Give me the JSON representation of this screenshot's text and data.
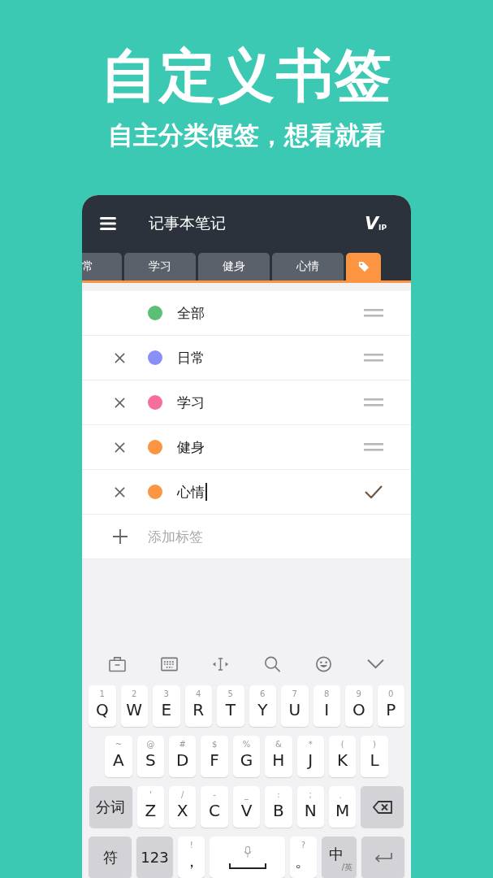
{
  "headline": "自定义书签",
  "subtitle": "自主分类便签，想看就看",
  "app": {
    "title": "记事本笔记",
    "vip_badge": {
      "main": "V",
      "sub": "IP"
    },
    "tabs": [
      {
        "kind": "text",
        "label": "常",
        "selected": false
      },
      {
        "kind": "text",
        "label": "学习",
        "selected": false
      },
      {
        "kind": "text",
        "label": "健身",
        "selected": false
      },
      {
        "kind": "text",
        "label": "心情",
        "selected": false
      },
      {
        "kind": "icon",
        "selected": true
      }
    ],
    "tags": [
      {
        "name": "全部",
        "color": "#5cbf78",
        "removable": false,
        "editing": false
      },
      {
        "name": "日常",
        "color": "#8a8ff5",
        "removable": true,
        "editing": false
      },
      {
        "name": "学习",
        "color": "#f76e9b",
        "removable": true,
        "editing": false
      },
      {
        "name": "健身",
        "color": "#fb9541",
        "removable": true,
        "editing": false
      },
      {
        "name": "心情",
        "color": "#fb9541",
        "removable": true,
        "editing": true
      }
    ],
    "add_placeholder": "添加标签"
  },
  "keyboard": {
    "key_rows": [
      {
        "keys": [
          {
            "kind": "letter",
            "hint": "1",
            "main": "Q"
          },
          {
            "kind": "letter",
            "hint": "2",
            "main": "W"
          },
          {
            "kind": "letter",
            "hint": "3",
            "main": "E"
          },
          {
            "kind": "letter",
            "hint": "4",
            "main": "R"
          },
          {
            "kind": "letter",
            "hint": "5",
            "main": "T"
          },
          {
            "kind": "letter",
            "hint": "6",
            "main": "Y"
          },
          {
            "kind": "letter",
            "hint": "7",
            "main": "U"
          },
          {
            "kind": "letter",
            "hint": "8",
            "main": "I"
          },
          {
            "kind": "letter",
            "hint": "9",
            "main": "O"
          },
          {
            "kind": "letter",
            "hint": "0",
            "main": "P"
          }
        ]
      },
      {
        "keys": [
          {
            "kind": "letter",
            "hint": "~",
            "main": "A"
          },
          {
            "kind": "letter",
            "hint": "@",
            "main": "S"
          },
          {
            "kind": "letter",
            "hint": "#",
            "main": "D"
          },
          {
            "kind": "letter",
            "hint": "$",
            "main": "F"
          },
          {
            "kind": "letter",
            "hint": "%",
            "main": "G"
          },
          {
            "kind": "letter",
            "hint": "&",
            "main": "H"
          },
          {
            "kind": "letter",
            "hint": "*",
            "main": "J"
          },
          {
            "kind": "letter",
            "hint": "(",
            "main": "K"
          },
          {
            "kind": "letter",
            "hint": ")",
            "main": "L"
          }
        ]
      },
      {
        "keys": [
          {
            "kind": "wide",
            "main": "分词"
          },
          {
            "kind": "letter",
            "hint": "'",
            "main": "Z"
          },
          {
            "kind": "letter",
            "hint": "/",
            "main": "X"
          },
          {
            "kind": "letter",
            "hint": "-",
            "main": "C"
          },
          {
            "kind": "letter",
            "hint": "_",
            "main": "V"
          },
          {
            "kind": "letter",
            "hint": ":",
            "main": "B"
          },
          {
            "kind": "letter",
            "hint": ";",
            "main": "N"
          },
          {
            "kind": "letter",
            "hint": "、",
            "main": "M"
          },
          {
            "kind": "backspace"
          }
        ]
      },
      {
        "keys": [
          {
            "kind": "wide",
            "main": "符"
          },
          {
            "kind": "mid",
            "main": "123"
          },
          {
            "kind": "letter",
            "hint": "!",
            "main": "，"
          },
          {
            "kind": "space"
          },
          {
            "kind": "letter",
            "hint": "?",
            "main": "。"
          },
          {
            "kind": "lang",
            "main": "中",
            "hint": "/英"
          },
          {
            "kind": "enter"
          }
        ]
      }
    ]
  }
}
